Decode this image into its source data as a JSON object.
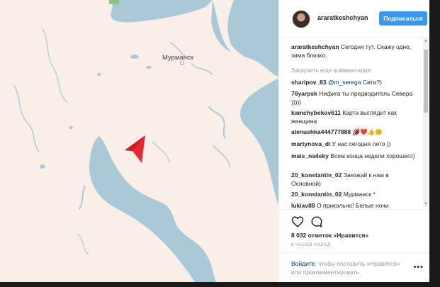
{
  "post": {
    "username": "araratkeshchyan",
    "follow_label": "Подписаться",
    "caption_user": "araratkeshchyan",
    "caption_text": "Сегодня тут. Скажу одно, зима близко.",
    "load_more": "Загрузить еще комментарии",
    "likes": "8 032 отметок «Нравится»",
    "time_ago": "8 ЧАСОВ НАЗАД",
    "login_link_like": "Войдите",
    "login_text_mid": ", чтобы поставить «Нравится»",
    "login_text_end": "или прокомментировать."
  },
  "map": {
    "city_label": "Мурманск"
  },
  "comments": [
    {
      "user": "sharipov_83",
      "mention": "@m_serega",
      "text": "Сити?)"
    },
    {
      "user": "76yarpsk",
      "mention": "",
      "text": "Нифига ты предводитель Севера )))))"
    },
    {
      "user": "kamchybekov611",
      "mention": "",
      "text": "Карта выглядит как женщина"
    },
    {
      "user": "alenushka444777888",
      "mention": "",
      "text": "🏈❤️👍😊"
    },
    {
      "user": "martynova_di",
      "mention": "",
      "text": "У нас сегодня лето ))"
    },
    {
      "user": "mais_na4eky",
      "mention": "",
      "text": "Всем конца недели хорошего)"
    },
    {
      "user": "20_konstantin_02",
      "mention": "",
      "text": "Заезжай к нам в Основной)"
    },
    {
      "user": "20_konstantin_02",
      "mention": "",
      "text": "Мурманск *"
    },
    {
      "user": "lukiav88",
      "mention": "",
      "text": "О прикольно! Белые ночи"
    }
  ],
  "icons": {
    "like": "heart-icon",
    "comment": "speech-bubble-icon",
    "more": "ellipsis-icon",
    "pointer": "location-arrow-icon"
  },
  "colors": {
    "follow_button": "#3897f0",
    "land": "#faeee8",
    "water": "#aac9d8",
    "arrow": "#e8282f"
  }
}
